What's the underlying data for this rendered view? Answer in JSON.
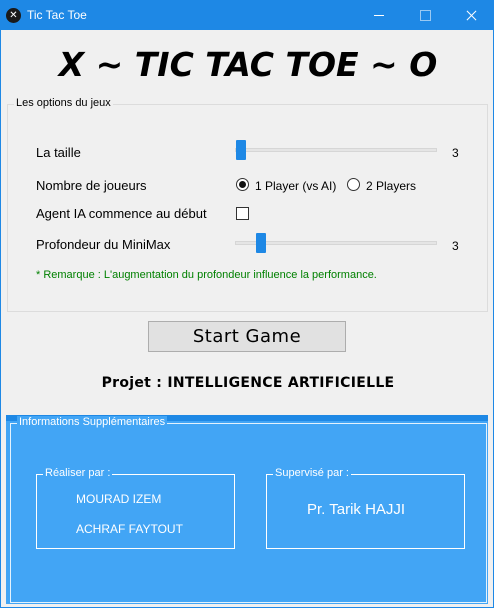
{
  "window": {
    "title": "Tic Tac Toe",
    "icon": "x-circle-icon",
    "accent_color": "#1e88e5"
  },
  "header": {
    "title": "X ~ TIC TAC TOE ~ O"
  },
  "options": {
    "legend": "Les options du jeux",
    "taille": {
      "label": "La taille",
      "value": "3",
      "slider_level": 0.0
    },
    "joueurs": {
      "label": "Nombre de joueurs",
      "option1": "1 Player (vs AI)",
      "option2": "2 Players",
      "selected": "1 Player (vs AI)"
    },
    "ai_start": {
      "label": "Agent IA commence au début",
      "checked": false
    },
    "minimax": {
      "label": "Profondeur du MiniMax",
      "value": "3",
      "slider_level": 0.2
    },
    "remark": "* Remarque : L'augmentation du profondeur influence la performance.",
    "remark_color": "#008000"
  },
  "start_button": "Start Game",
  "projet": "Projet : INTELLIGENCE ARTIFICIELLE",
  "info": {
    "legend": "Informations Supplémentaires",
    "panel_color": "#42a5f5",
    "realiser": {
      "legend": "Réaliser par :",
      "names": [
        "MOURAD IZEM",
        "ACHRAF FAYTOUT"
      ]
    },
    "supervise": {
      "legend": "Supervisé par :",
      "name": "Pr. Tarik HAJJI"
    }
  }
}
